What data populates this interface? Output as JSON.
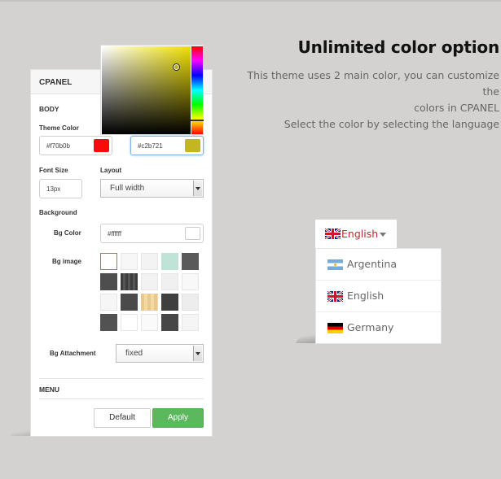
{
  "headline": "Unlimited color option",
  "description": [
    "This theme uses 2 main color, you can customize the",
    "colors in CPANEL",
    "Select the color by selecting the language"
  ],
  "cpanel": {
    "title": "CPANEL",
    "body_label": "BODY",
    "theme_color_label": "Theme Color",
    "theme_color_1": {
      "value": "#f70b0b",
      "swatch": "#f70b0b"
    },
    "theme_color_2": {
      "value": "#c2b721",
      "swatch": "#c2b721"
    },
    "font_size_label": "Font Size",
    "font_size_value": "13px",
    "layout_label": "Layout",
    "layout_value": "Full width",
    "background_label": "Background",
    "bg_color_label": "Bg Color",
    "bg_color_value": "#ffffff",
    "bg_image_label": "Bg image",
    "bg_attachment_label": "Bg Attachment",
    "bg_attachment_value": "fixed",
    "menu_label": "MENU",
    "default_button": "Default",
    "apply_button": "Apply"
  },
  "colors": {
    "picker_hue": "#f0e000",
    "apply_green": "#5cb85c",
    "lang_selected": "#c0282d"
  },
  "language": {
    "selected": "English",
    "options": [
      {
        "label": "Argentina",
        "flag": "flag-argentina-icon"
      },
      {
        "label": "English",
        "flag": "flag-uk-icon"
      },
      {
        "label": "Germany",
        "flag": "flag-germany-icon"
      }
    ]
  }
}
